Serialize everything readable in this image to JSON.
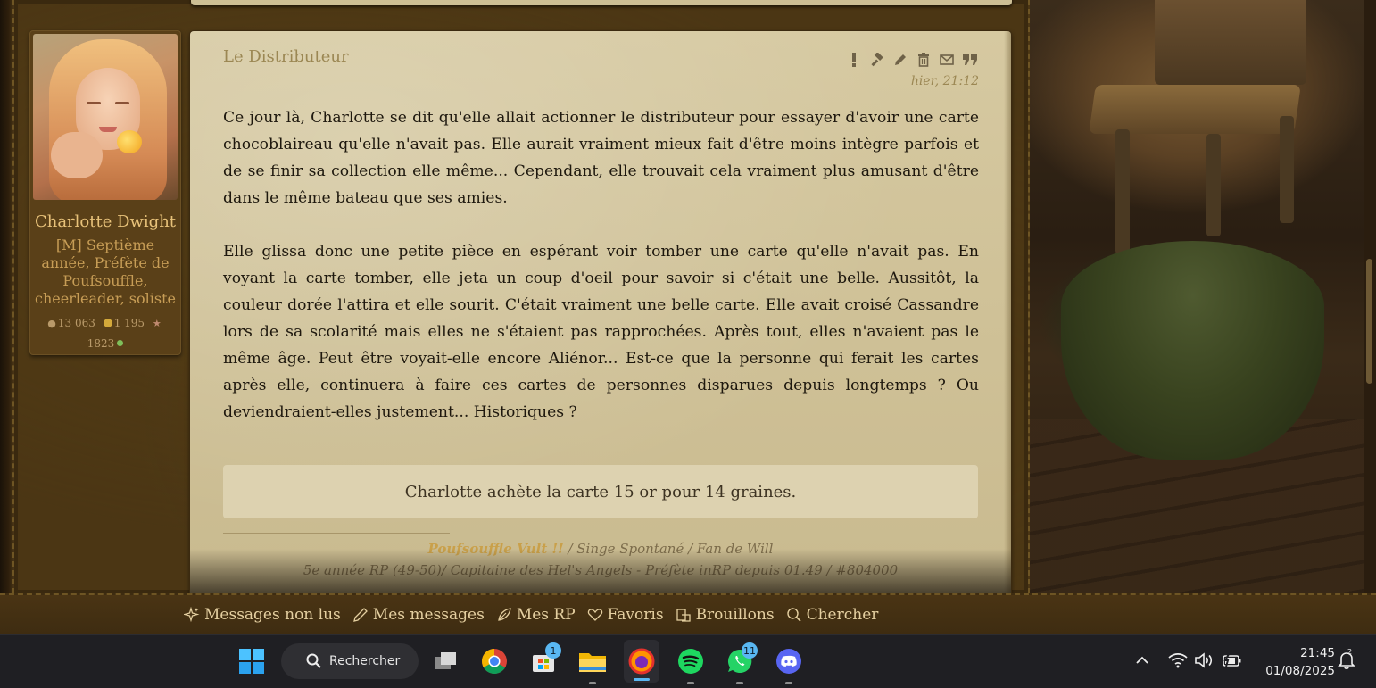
{
  "post": {
    "title": "Le Distributeur",
    "date": "hier, 21:12",
    "actions": [
      "report-icon",
      "gavel-icon",
      "pencil-icon",
      "trash-icon",
      "envelope-icon",
      "quote-icon"
    ],
    "paragraphs": [
      "Ce jour là, Charlotte se dit qu'elle allait actionner le distributeur pour essayer d'avoir une carte chocoblaireau qu'elle n'avait pas. Elle aurait vraiment mieux fait d'être moins intègre parfois et de se finir sa collection elle même... Cependant, elle trouvait cela vraiment plus amusant d'être dans le même bateau que ses amies.",
      "Elle glissa donc une petite pièce en espérant voir tomber une carte qu'elle n'avait pas. En voyant la carte tomber, elle jeta un coup d'oeil pour savoir si c'était une belle. Aussitôt, la couleur dorée l'attira et elle sourit. C'était vraiment une belle carte. Elle avait croisé Cassandre lors de sa scolarité mais elles ne s'étaient pas rapprochées. Après tout, elles n'avaient pas le même âge. Peut être voyait-elle encore Aliénor... Est-ce que la personne qui ferait les cartes après elle, continuera à faire ces cartes de personnes disparues depuis longtemps ? Ou deviendraient-elles justement... Historiques ?"
    ],
    "purchase": "Charlotte achète la carte 15 or pour 14 graines.",
    "signature": {
      "highlight": "Poufsouffle Vult !!",
      "line1_rest": " / Singe Spontané / Fan de Will",
      "line2": "5e année RP (49-50)/ Capitaine des Hel's Angels - Préfète inRP depuis 01.49 / #804000"
    }
  },
  "author": {
    "name": "Charlotte Dwight",
    "rank": "[M] Septième année, Préfète de Poufsouffle, cheerleader, soliste",
    "messages": "13 063",
    "coins": "1 195",
    "stars": "1823"
  },
  "nav": {
    "unread": "Messages non lus",
    "mine": "Mes messages",
    "rp": "Mes RP",
    "favs": "Favoris",
    "drafts": "Brouillons",
    "search": "Chercher"
  },
  "taskbar": {
    "search_label": "Rechercher",
    "store_badge": "1",
    "whatsapp_badge": "11",
    "time": "21:45",
    "date": "01/08/2025",
    "notification_count": "2"
  },
  "colors": {
    "leather": "#4b3614",
    "parchment": "#d6c9a1",
    "gold_text": "#e8c27a",
    "accent_blue": "#59b7f2"
  }
}
